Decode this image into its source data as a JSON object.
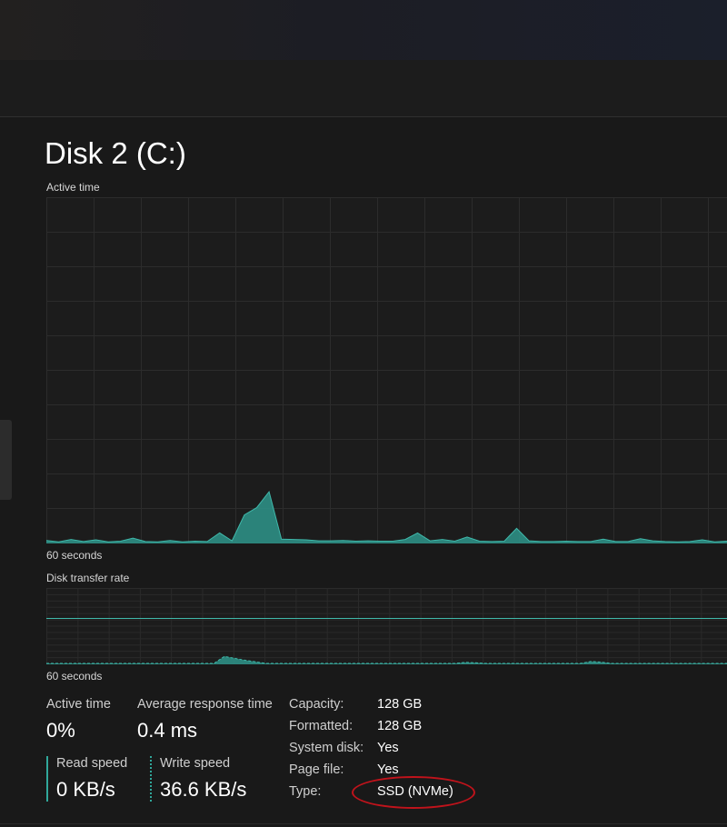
{
  "page": {
    "title": "Disk 2 (C:)"
  },
  "active_time_graph": {
    "label": "Active time",
    "axis_label": "60 seconds",
    "utilization_percent": [
      0.6,
      0.2,
      0.9,
      0.3,
      0.8,
      0.2,
      0.4,
      1.3,
      0.3,
      0.2,
      0.6,
      0.2,
      0.4,
      0.3,
      2.8,
      0.5,
      8.0,
      10.1,
      14.7,
      1.0,
      0.9,
      0.8,
      0.5,
      0.5,
      0.6,
      0.4,
      0.5,
      0.4,
      0.4,
      0.9,
      2.8,
      0.5,
      0.9,
      0.4,
      1.6,
      0.4,
      0.3,
      0.4,
      4.1,
      0.5,
      0.3,
      0.3,
      0.4,
      0.3,
      0.3,
      1.0,
      0.3,
      0.3,
      1.1,
      0.5,
      0.3,
      0.2,
      0.3,
      0.8,
      0.2,
      0.4
    ],
    "colors": {
      "grid": "#2c2c2c",
      "fill": "#2e958b",
      "stroke": "#3fb8aa"
    }
  },
  "transfer_rate_graph": {
    "label": "Disk transfer rate",
    "axis_label": "60 seconds",
    "activity_level": [
      0,
      0,
      0,
      0,
      0,
      0,
      0,
      0,
      0,
      0,
      0,
      0,
      0,
      0,
      0,
      0,
      0,
      0.55,
      0.4,
      0.25,
      0.12,
      0,
      0,
      0,
      0,
      0,
      0,
      0,
      0,
      0,
      0,
      0,
      0,
      0,
      0,
      0,
      0,
      0,
      0,
      0,
      0.08,
      0.05,
      0,
      0,
      0,
      0,
      0,
      0,
      0,
      0,
      0,
      0,
      0.15,
      0.1,
      0,
      0,
      0,
      0,
      0,
      0,
      0,
      0,
      0,
      0,
      0,
      0
    ],
    "colors": {
      "grid": "#2a2a2a",
      "fill": "#2e958b",
      "stroke": "#3fb8aa"
    }
  },
  "stats": {
    "active_time": {
      "label": "Active time",
      "value": "0%"
    },
    "avg_response": {
      "label": "Average response time",
      "value": "0.4 ms"
    },
    "read_speed": {
      "label": "Read speed",
      "value": "0 KB/s"
    },
    "write_speed": {
      "label": "Write speed",
      "value": "36.6 KB/s"
    }
  },
  "properties": {
    "capacity": {
      "label": "Capacity:",
      "value": "128 GB"
    },
    "formatted": {
      "label": "Formatted:",
      "value": "128 GB"
    },
    "system_disk": {
      "label": "System disk:",
      "value": "Yes"
    },
    "page_file": {
      "label": "Page file:",
      "value": "Yes"
    },
    "type": {
      "label": "Type:",
      "value": "SSD (NVMe)"
    }
  },
  "colors": {
    "accent": "#30a89b",
    "highlight_ring": "#c0131b",
    "background": "#191919"
  }
}
